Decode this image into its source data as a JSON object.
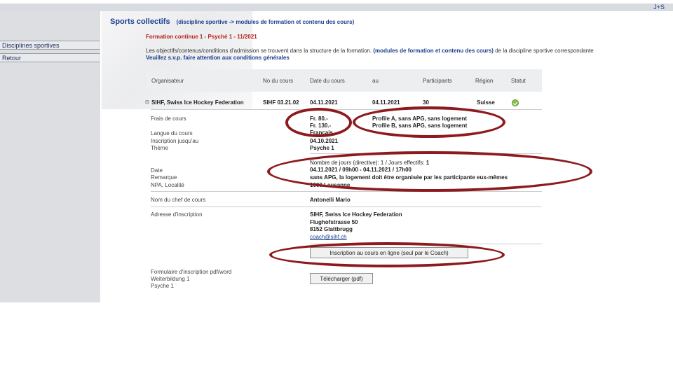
{
  "topbar": {
    "logo": "J+S"
  },
  "sidebar": {
    "items": [
      {
        "label": "Disciplines sportives"
      },
      {
        "label": "Retour"
      }
    ]
  },
  "header": {
    "title": "Sports collectifs",
    "subtitle": "(discipline sportive -> modules de formation et contenu des cours)"
  },
  "course": {
    "title": "Formation continue 1 - Psyché 1 - 11/2021",
    "info_prefix": "Les objectifs/contenus/conditions d'admission se trouvent dans la structure de la formation.",
    "info_link": "(modules de formation et contenu des cours)",
    "info_suffix": "de la discipline sportive correspondante",
    "info_line2": "Veuillez s.v.p. faire attention aux conditions générales"
  },
  "table": {
    "headers": [
      "Organisateur",
      "No du cours",
      "Date du cours",
      "au",
      "Participants",
      "Région",
      "Statut"
    ],
    "row": {
      "organisateur": "SIHF, Swiss Ice Hockey Federation",
      "no_cours": "SIHF 03.21.02",
      "date_debut": "04.11.2021",
      "date_fin": "04.11.2021",
      "participants": "30",
      "region": "Suisse"
    }
  },
  "details": {
    "frais_label": "Frais de cours",
    "frais_1": "Fr. 80.-",
    "frais_2": "Fr. 130.-",
    "profile_1": "Profile A, sans APG, sans logement",
    "profile_2": "Profile B, sans APG, sans logement",
    "langue_label": "Langue du cours",
    "langue_value": "Français",
    "inscription_label": "Inscription jusqu'au",
    "inscription_value": "04.10.2021",
    "theme_label": "Thème",
    "theme_value": "Psyche 1",
    "nb_jours": "Nombre de jours (directive): 1 / Jours effectifs:",
    "nb_jours_value": "1",
    "date_label": "Date",
    "date_value": "04.11.2021 / 09h00 - 04.11.2021 / 17h00",
    "remarque_label": "Remarque",
    "remarque_value": "sans APG, la logement doit être organisée par les participante eux-mêmes",
    "npa_label": "NPA, Localité",
    "npa_value": "1000 Lausanne",
    "chef_label": "Nom du chef de cours",
    "chef_value": "Antonelli Mario",
    "adresse_label": "Adresse d'inscription",
    "adresse_1": "SIHF, Swiss Ice Hockey Federation",
    "adresse_2": "Flughofstrasse 50",
    "adresse_3": "8152 Glattbrugg",
    "adresse_email": "coach@sihf.ch",
    "inscription_button": "Inscription au cours en ligne (seul par le Coach)",
    "formulaire_1": "Formulaire d'inscription pdf/word",
    "formulaire_2": "Weiterbildung 1",
    "formulaire_3": "Psyche 1",
    "download_button": "Télécharger (pdf)"
  }
}
